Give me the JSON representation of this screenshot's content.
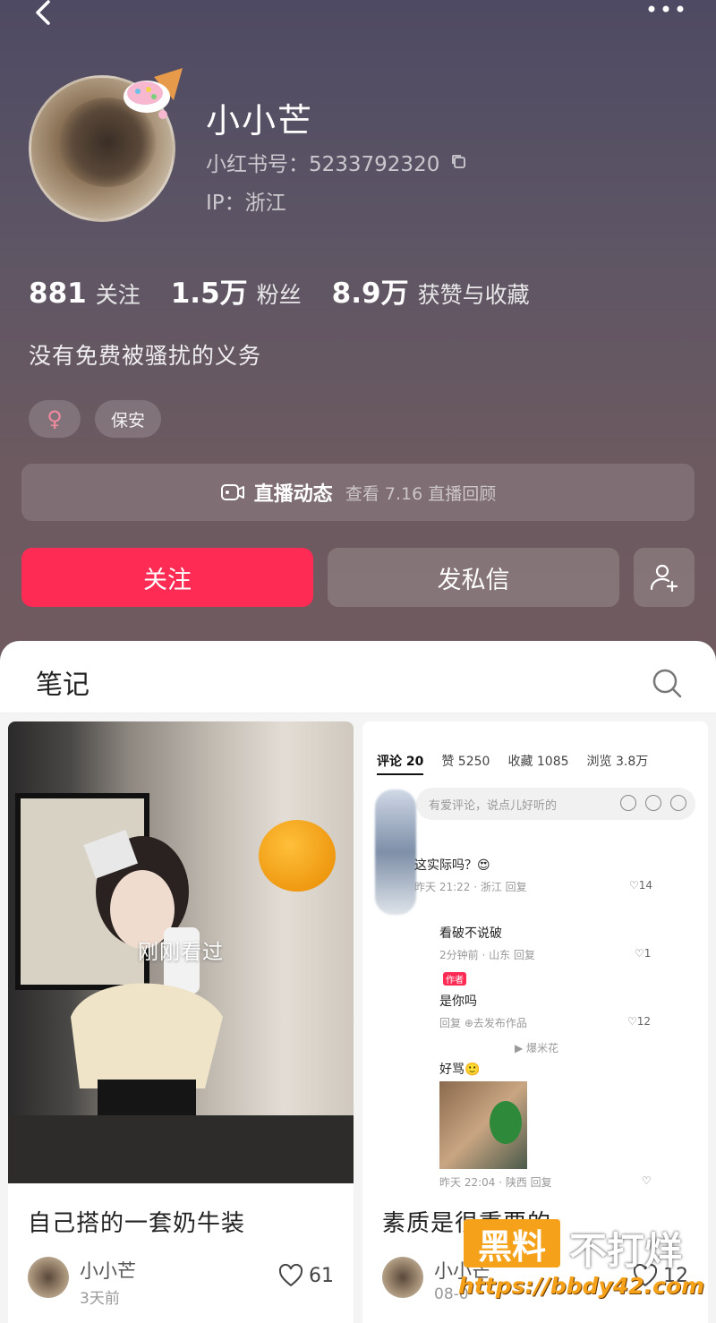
{
  "profile": {
    "name": "小小芒",
    "red_id": "小红书号：5233792320",
    "ip": "IP：浙江",
    "stats": [
      {
        "num": "881",
        "label": "关注"
      },
      {
        "num": "1.5万",
        "label": "粉丝"
      },
      {
        "num": "8.9万",
        "label": "获赞与收藏"
      }
    ],
    "bio": "没有免费被骚扰的义务",
    "tags": {
      "gender": "♀",
      "job": "保安"
    }
  },
  "live": {
    "title": "直播动态",
    "subtitle": "查看 7.16 直播回顾"
  },
  "actions": {
    "follow": "关注",
    "message": "发私信"
  },
  "notes_tab": {
    "label": "笔记"
  },
  "cards": [
    {
      "overlay": "刚刚看过",
      "title": "自己搭的一套奶牛装",
      "author": "小小芒",
      "date": "3天前",
      "likes": "61"
    },
    {
      "title": "素质是很重要的",
      "author": "小小芒",
      "date": "08-0",
      "likes": "12",
      "screenshot": {
        "tabs": [
          "评论 20",
          "赞 5250",
          "收藏 1085",
          "浏览 3.8万"
        ],
        "input_placeholder": "有爱评论，说点儿好听的",
        "comments": [
          {
            "text": "这实际吗？😍",
            "meta": "昨天 21:22 · 浙江   回复",
            "likes": "♡14"
          },
          {
            "text": "看破不说破",
            "meta": "2分钟前 · 山东   回复",
            "likes": "♡1"
          },
          {
            "author_tag": "作者",
            "text": "是你吗",
            "meta": "回复   ⊕去发布作品",
            "likes": "♡12"
          },
          {
            "ref": "▶ 爆米花",
            "text": "好骂🙂",
            "meta": "昨天 22:04 · 陕西   回复",
            "likes": "♡"
          }
        ]
      }
    }
  ],
  "watermark": {
    "brand_a": "黑料",
    "brand_b": "不打烊",
    "url": "https://bbdy42.com"
  },
  "colors": {
    "accent": "#fe2c55",
    "header": "#5d5565"
  }
}
